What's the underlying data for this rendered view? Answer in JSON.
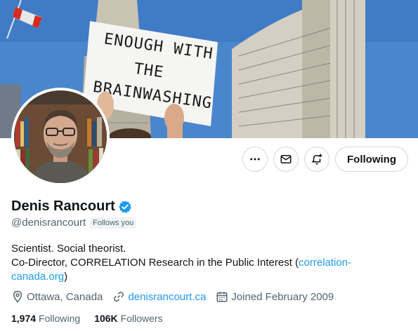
{
  "banner": {
    "sign_lines": [
      "ENOUGH WITH",
      "THE",
      "BRAINWASHING"
    ],
    "sky_color": "#4a86cc"
  },
  "actions": {
    "more_icon": "more-icon",
    "message_icon": "mail-icon",
    "notify_icon": "notification-bell-icon",
    "follow_label": "Following"
  },
  "profile": {
    "name": "Denis Rancourt",
    "verified_icon": "verified-badge-icon",
    "verified_color": "#1d9bf0",
    "handle": "@denisrancourt",
    "follows_you": "Follows you",
    "bio_line1": "Scientist. Social theorist.",
    "bio_line2_text": "Co-Director, CORRELATION Research in the Public Interest (",
    "bio_link": "correlation-canada.org",
    "bio_line2_end": ")",
    "location": "Ottawa, Canada",
    "website": "denisrancourt.ca",
    "joined": "Joined February 2009"
  },
  "stats": {
    "following_count": "1,974",
    "following_label": "Following",
    "followers_count": "106K",
    "followers_label": "Followers"
  }
}
